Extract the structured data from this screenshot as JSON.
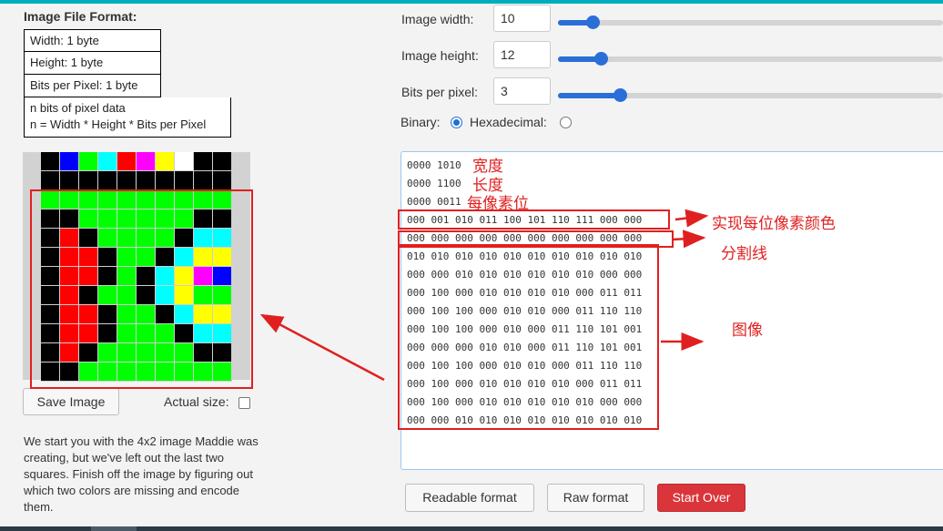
{
  "format": {
    "title": "Image File Format:",
    "width_row": "Width: 1 byte",
    "height_row": "Height: 1 byte",
    "bpp_row": "Bits per Pixel: 1 byte",
    "pixel_line1": "n bits of pixel data",
    "pixel_line2": "n = Width * Height * Bits per Pixel"
  },
  "pixel_grid": {
    "columns": 10,
    "rows": 12,
    "palette": {
      "0": "#000000",
      "1": "#0000ff",
      "2": "#00ff00",
      "3": "#00ffff",
      "4": "#ff0000",
      "5": "#ff00ff",
      "6": "#ffff00",
      "7": "#ffffff"
    },
    "pixels": [
      [
        0,
        1,
        2,
        3,
        4,
        5,
        6,
        7,
        0,
        0
      ],
      [
        0,
        0,
        0,
        0,
        0,
        0,
        0,
        0,
        0,
        0
      ],
      [
        2,
        2,
        2,
        2,
        2,
        2,
        2,
        2,
        2,
        2
      ],
      [
        0,
        0,
        2,
        2,
        2,
        2,
        2,
        2,
        0,
        0
      ],
      [
        0,
        4,
        0,
        2,
        2,
        2,
        2,
        0,
        3,
        3
      ],
      [
        0,
        4,
        4,
        0,
        2,
        2,
        0,
        3,
        6,
        6
      ],
      [
        0,
        4,
        4,
        0,
        2,
        0,
        3,
        6,
        5,
        1
      ],
      [
        0,
        4,
        0,
        2,
        2,
        0,
        3,
        6,
        2,
        2
      ],
      [
        0,
        4,
        4,
        0,
        2,
        2,
        0,
        3,
        6,
        6
      ],
      [
        0,
        4,
        4,
        0,
        2,
        2,
        2,
        0,
        3,
        3
      ],
      [
        0,
        4,
        0,
        2,
        2,
        2,
        2,
        2,
        0,
        0
      ],
      [
        0,
        0,
        2,
        2,
        2,
        2,
        2,
        2,
        2,
        2
      ]
    ]
  },
  "left": {
    "save_image": "Save Image",
    "actual_size": "Actual size:",
    "description": "We start you with the 4x2 image Maddie was creating, but we've left out the last two squares. Finish off the image by figuring out which two colors are missing and encode them."
  },
  "controls": {
    "width_label": "Image width:",
    "width_value": "10",
    "height_label": "Image height:",
    "height_value": "12",
    "bpp_label": "Bits per pixel:",
    "bpp_value": "3",
    "width_slider": 0.09,
    "height_slider": 0.11,
    "bpp_slider": 0.16,
    "binary_label": "Binary:",
    "hex_label": "Hexadecimal:",
    "binary_selected": true
  },
  "data_rows": [
    "0000 1010",
    "0000 1100",
    "0000 0011",
    "000 001 010 011 100 101 110 111 000 000",
    "000 000 000 000 000 000 000 000 000 000",
    "010 010 010 010 010 010 010 010 010 010",
    "000 000 010 010 010 010 010 010 000 000",
    "000 100 000 010 010 010 010 000 011 011",
    "000 100 100 000 010 010 000 011 110 110",
    "000 100 100 000 010 000 011 110 101 001",
    "000 000 000 010 010 000 011 110 101 001",
    "000 100 100 000 010 010 000 011 110 110",
    "000 100 000 010 010 010 010 000 011 011",
    "000 100 000 010 010 010 010 010 000 000",
    "000 000 010 010 010 010 010 010 010 010"
  ],
  "annotations": {
    "width_note": "宽度",
    "height_note": "长度",
    "bpp_note": "每像素位",
    "colors_note": "实现每位像素颜色",
    "divider_note": "分割线",
    "image_note": "图像",
    "color": "#e02020"
  },
  "buttons": {
    "readable": "Readable format",
    "raw": "Raw format",
    "start_over": "Start Over"
  }
}
